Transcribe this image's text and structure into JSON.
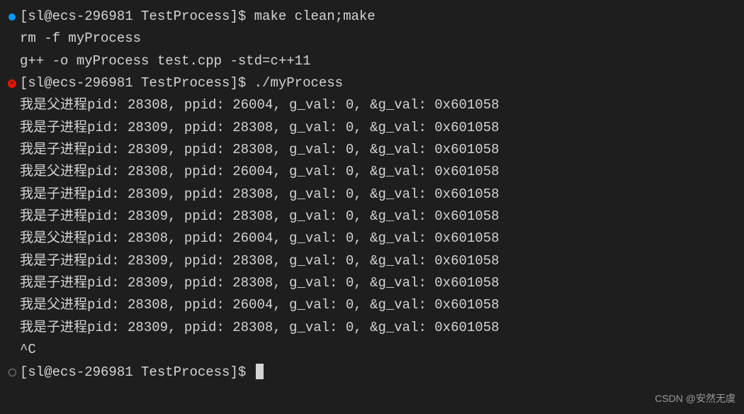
{
  "prompt": "[sl@ecs-296981 TestProcess]$ ",
  "commands": {
    "make": "make clean;make",
    "run": "./myProcess"
  },
  "make_output": {
    "line1": "rm -f myProcess",
    "line2": "g++ -o myProcess test.cpp -std=c++11"
  },
  "process_lines": [
    "我是父进程pid: 28308, ppid: 26004, g_val: 0, &g_val: 0x601058",
    "我是子进程pid: 28309, ppid: 28308, g_val: 0, &g_val: 0x601058",
    "我是子进程pid: 28309, ppid: 28308, g_val: 0, &g_val: 0x601058",
    "我是父进程pid: 28308, ppid: 26004, g_val: 0, &g_val: 0x601058",
    "我是子进程pid: 28309, ppid: 28308, g_val: 0, &g_val: 0x601058",
    "我是子进程pid: 28309, ppid: 28308, g_val: 0, &g_val: 0x601058",
    "我是父进程pid: 28308, ppid: 26004, g_val: 0, &g_val: 0x601058",
    "我是子进程pid: 28309, ppid: 28308, g_val: 0, &g_val: 0x601058",
    "我是子进程pid: 28309, ppid: 28308, g_val: 0, &g_val: 0x601058",
    "我是父进程pid: 28308, ppid: 26004, g_val: 0, &g_val: 0x601058",
    "我是子进程pid: 28309, ppid: 28308, g_val: 0, &g_val: 0x601058"
  ],
  "interrupt": "^C",
  "watermark": "CSDN @安然无虞"
}
